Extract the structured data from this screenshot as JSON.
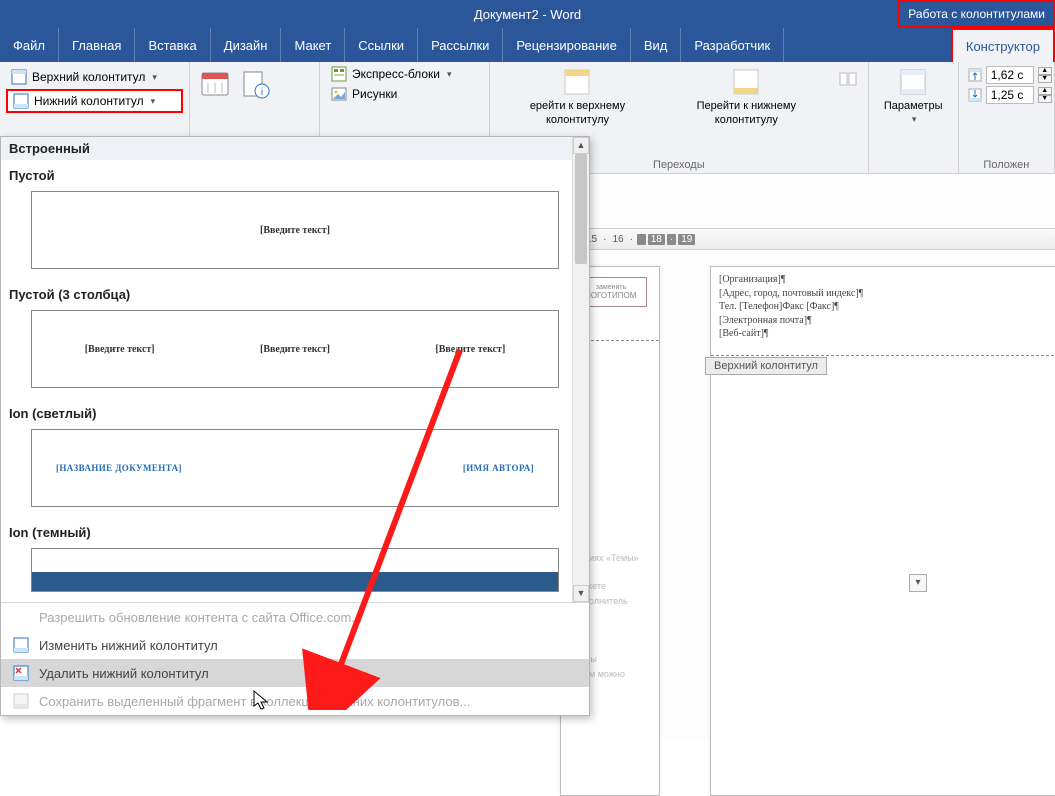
{
  "title": "Документ2 - Word",
  "contextual_tab_group": "Работа с колонтитулами",
  "tabs": {
    "file": "Файл",
    "home": "Главная",
    "insert": "Вставка",
    "design": "Дизайн",
    "layout": "Макет",
    "references": "Ссылки",
    "mailings": "Рассылки",
    "review": "Рецензирование",
    "view": "Вид",
    "developer": "Разработчик",
    "constructor": "Конструктор"
  },
  "ribbon": {
    "header_btn": "Верхний колонтитул",
    "footer_btn": "Нижний колонтитул",
    "express_blocks": "Экспресс-блоки",
    "pictures": "Рисунки",
    "goto_header": "ерейти к верхнему колонтитулу",
    "goto_footer": "Перейти к нижнему колонтитулу",
    "navigation_group": "Переходы",
    "parameters": "Параметры",
    "position_group": "Положен",
    "pos_top": "1,62 с",
    "pos_bottom": "1,25 с"
  },
  "gallery": {
    "builtin": "Встроенный",
    "sec_empty": "Пустой",
    "sec_empty3": "Пустой (3 столбца)",
    "sec_ion_light": "Ion (светлый)",
    "sec_ion_dark": "Ion (темный)",
    "ph_text": "[Введите текст]",
    "ph_doc_title": "[НАЗВАНИЕ ДОКУМЕНТА]",
    "ph_author": "[ИМЯ АВТОРА]",
    "menu_office_update": "Разрешить обновление контента с сайта Office.com...",
    "menu_edit_footer": "Изменить нижний колонтитул",
    "menu_delete_footer": "Удалить нижний колонтитул",
    "menu_save_selection": "Сохранить выделенный фрагмент в коллекцию нижних колонтитулов..."
  },
  "ruler": {
    "t15": "15",
    "t16": "16",
    "t18": "18",
    "t19": "19"
  },
  "doc": {
    "logo_label": "ЛОГОТИПОМ",
    "logo_sub": "заменить",
    "org": "[Организация]¶",
    "addr": "[Адрес, город, почтовый индекс]¶",
    "tel": "Тел. [Телефон]Факс [Факс]¶",
    "email": "[Электронная почта]¶",
    "web": "[Веб-сайт]¶",
    "header_tag": "Верхний колонтитул",
    "partial1": "екциях «Темы»",
    "partial2": "можете",
    "partial3": "заполнитель",
    "partial4": "лоны",
    "partial5": "аком можно"
  }
}
